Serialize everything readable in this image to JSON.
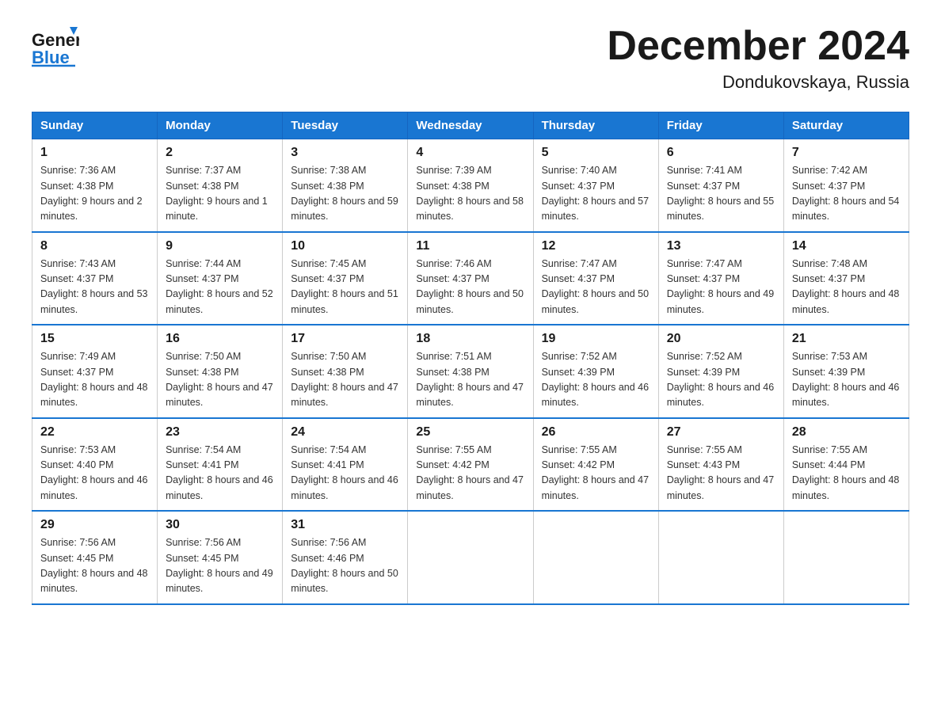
{
  "header": {
    "logo_general": "General",
    "logo_blue": "Blue",
    "title": "December 2024",
    "location": "Dondukovskaya, Russia"
  },
  "weekdays": [
    "Sunday",
    "Monday",
    "Tuesday",
    "Wednesday",
    "Thursday",
    "Friday",
    "Saturday"
  ],
  "weeks": [
    [
      {
        "day": "1",
        "sunrise": "7:36 AM",
        "sunset": "4:38 PM",
        "daylight": "9 hours and 2 minutes."
      },
      {
        "day": "2",
        "sunrise": "7:37 AM",
        "sunset": "4:38 PM",
        "daylight": "9 hours and 1 minute."
      },
      {
        "day": "3",
        "sunrise": "7:38 AM",
        "sunset": "4:38 PM",
        "daylight": "8 hours and 59 minutes."
      },
      {
        "day": "4",
        "sunrise": "7:39 AM",
        "sunset": "4:38 PM",
        "daylight": "8 hours and 58 minutes."
      },
      {
        "day": "5",
        "sunrise": "7:40 AM",
        "sunset": "4:37 PM",
        "daylight": "8 hours and 57 minutes."
      },
      {
        "day": "6",
        "sunrise": "7:41 AM",
        "sunset": "4:37 PM",
        "daylight": "8 hours and 55 minutes."
      },
      {
        "day": "7",
        "sunrise": "7:42 AM",
        "sunset": "4:37 PM",
        "daylight": "8 hours and 54 minutes."
      }
    ],
    [
      {
        "day": "8",
        "sunrise": "7:43 AM",
        "sunset": "4:37 PM",
        "daylight": "8 hours and 53 minutes."
      },
      {
        "day": "9",
        "sunrise": "7:44 AM",
        "sunset": "4:37 PM",
        "daylight": "8 hours and 52 minutes."
      },
      {
        "day": "10",
        "sunrise": "7:45 AM",
        "sunset": "4:37 PM",
        "daylight": "8 hours and 51 minutes."
      },
      {
        "day": "11",
        "sunrise": "7:46 AM",
        "sunset": "4:37 PM",
        "daylight": "8 hours and 50 minutes."
      },
      {
        "day": "12",
        "sunrise": "7:47 AM",
        "sunset": "4:37 PM",
        "daylight": "8 hours and 50 minutes."
      },
      {
        "day": "13",
        "sunrise": "7:47 AM",
        "sunset": "4:37 PM",
        "daylight": "8 hours and 49 minutes."
      },
      {
        "day": "14",
        "sunrise": "7:48 AM",
        "sunset": "4:37 PM",
        "daylight": "8 hours and 48 minutes."
      }
    ],
    [
      {
        "day": "15",
        "sunrise": "7:49 AM",
        "sunset": "4:37 PM",
        "daylight": "8 hours and 48 minutes."
      },
      {
        "day": "16",
        "sunrise": "7:50 AM",
        "sunset": "4:38 PM",
        "daylight": "8 hours and 47 minutes."
      },
      {
        "day": "17",
        "sunrise": "7:50 AM",
        "sunset": "4:38 PM",
        "daylight": "8 hours and 47 minutes."
      },
      {
        "day": "18",
        "sunrise": "7:51 AM",
        "sunset": "4:38 PM",
        "daylight": "8 hours and 47 minutes."
      },
      {
        "day": "19",
        "sunrise": "7:52 AM",
        "sunset": "4:39 PM",
        "daylight": "8 hours and 46 minutes."
      },
      {
        "day": "20",
        "sunrise": "7:52 AM",
        "sunset": "4:39 PM",
        "daylight": "8 hours and 46 minutes."
      },
      {
        "day": "21",
        "sunrise": "7:53 AM",
        "sunset": "4:39 PM",
        "daylight": "8 hours and 46 minutes."
      }
    ],
    [
      {
        "day": "22",
        "sunrise": "7:53 AM",
        "sunset": "4:40 PM",
        "daylight": "8 hours and 46 minutes."
      },
      {
        "day": "23",
        "sunrise": "7:54 AM",
        "sunset": "4:41 PM",
        "daylight": "8 hours and 46 minutes."
      },
      {
        "day": "24",
        "sunrise": "7:54 AM",
        "sunset": "4:41 PM",
        "daylight": "8 hours and 46 minutes."
      },
      {
        "day": "25",
        "sunrise": "7:55 AM",
        "sunset": "4:42 PM",
        "daylight": "8 hours and 47 minutes."
      },
      {
        "day": "26",
        "sunrise": "7:55 AM",
        "sunset": "4:42 PM",
        "daylight": "8 hours and 47 minutes."
      },
      {
        "day": "27",
        "sunrise": "7:55 AM",
        "sunset": "4:43 PM",
        "daylight": "8 hours and 47 minutes."
      },
      {
        "day": "28",
        "sunrise": "7:55 AM",
        "sunset": "4:44 PM",
        "daylight": "8 hours and 48 minutes."
      }
    ],
    [
      {
        "day": "29",
        "sunrise": "7:56 AM",
        "sunset": "4:45 PM",
        "daylight": "8 hours and 48 minutes."
      },
      {
        "day": "30",
        "sunrise": "7:56 AM",
        "sunset": "4:45 PM",
        "daylight": "8 hours and 49 minutes."
      },
      {
        "day": "31",
        "sunrise": "7:56 AM",
        "sunset": "4:46 PM",
        "daylight": "8 hours and 50 minutes."
      },
      null,
      null,
      null,
      null
    ]
  ]
}
